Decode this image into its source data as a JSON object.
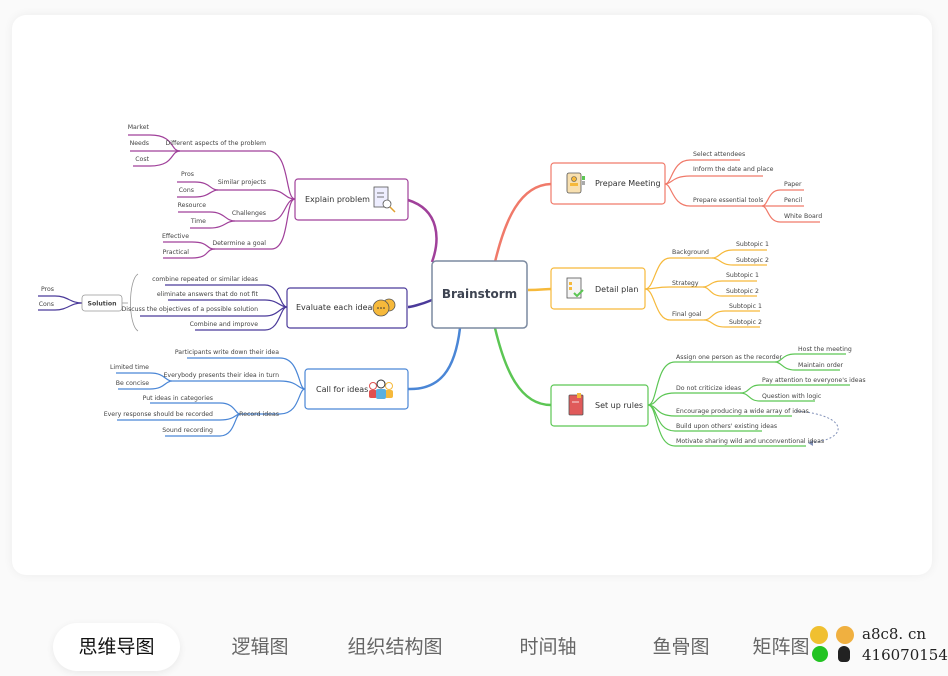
{
  "central": {
    "label": "Brainstorm"
  },
  "colors": {
    "explain": "#a0409a",
    "evaluate": "#4b3a9a",
    "call": "#4a86d6",
    "prepare": "#f07a6a",
    "detail": "#f6b93b",
    "rules": "#5cc654",
    "central_border": "#7c8aa0"
  },
  "topics": {
    "explain": {
      "label": "Explain problem",
      "icon": "document-search-icon",
      "children": [
        {
          "label": "Different aspects of the problem",
          "children": [
            "Market",
            "Needs",
            "Cost"
          ]
        },
        {
          "label": "Similar projects",
          "children": [
            "Pros",
            "Cons"
          ]
        },
        {
          "label": "Challenges",
          "children": [
            "Resource",
            "Time"
          ]
        },
        {
          "label": "Determine a goal",
          "children": [
            "Effective",
            "Practical"
          ]
        }
      ]
    },
    "evaluate": {
      "label": "Evaluate each idea",
      "icon": "chat-bubbles-icon",
      "children": [
        "combine repeated or similar ideas",
        "eliminate answers that do not fit",
        "Discuss the objectives of a possible solution",
        "Combine and improve"
      ],
      "summary": {
        "label": "Solution",
        "children": [
          "Pros",
          "Cons"
        ]
      }
    },
    "call": {
      "label": "Call for ideas",
      "icon": "people-group-icon",
      "children": [
        {
          "label": "Participants write down their idea",
          "children": []
        },
        {
          "label": "Everybody presents their idea in turn",
          "children": [
            "Limited time",
            "Be concise"
          ]
        },
        {
          "label": "Record ideas",
          "children": [
            "Put ideas in categories",
            "Every response should be recorded",
            "Sound recording"
          ]
        }
      ]
    },
    "prepare": {
      "label": "Prepare Meeting",
      "icon": "id-badge-icon",
      "children": [
        {
          "label": "Select attendees",
          "children": []
        },
        {
          "label": "Inform the date and place",
          "children": []
        },
        {
          "label": "Prepare essential tools",
          "children": [
            "Paper",
            "Pencil",
            "White Board"
          ]
        }
      ]
    },
    "detail": {
      "label": "Detail plan",
      "icon": "checklist-icon",
      "children": [
        {
          "label": "Background",
          "children": [
            "Subtopic 1",
            "Subtopic 2"
          ]
        },
        {
          "label": "Strategy",
          "children": [
            "Subtopic 1",
            "Subtopic 2"
          ]
        },
        {
          "label": "Final goal",
          "children": [
            "Subtopic 1",
            "Subtopic 2"
          ]
        }
      ]
    },
    "rules": {
      "label": "Set up rules",
      "icon": "book-icon",
      "children": [
        {
          "label": "Assign one person as the recorder",
          "children": [
            "Host the meeting",
            "Maintain order"
          ]
        },
        {
          "label": "Do not criticize ideas",
          "children": [
            "Pay attention to everyone's ideas",
            "Question with logic"
          ]
        },
        {
          "label": "Encourage producing a wide array of ideas",
          "children": []
        },
        {
          "label": "Build upon others' existing ideas",
          "children": []
        },
        {
          "label": "Motivate sharing wild and unconventional ideas",
          "children": []
        }
      ]
    }
  },
  "tabs": [
    {
      "label": "思维导图",
      "active": true
    },
    {
      "label": "逻辑图",
      "active": false
    },
    {
      "label": "组织结构图",
      "active": false
    },
    {
      "label": "时间轴",
      "active": false
    },
    {
      "label": "鱼骨图",
      "active": false
    },
    {
      "label": "矩阵图",
      "active": false
    }
  ],
  "watermark": {
    "line1": "a8c8. cn",
    "line2": "416070154"
  }
}
